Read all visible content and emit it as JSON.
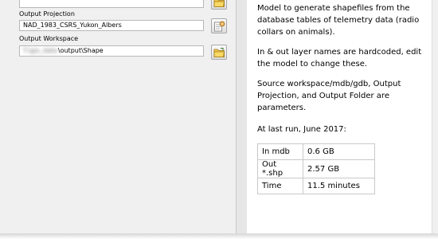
{
  "form": {
    "output_projection": {
      "label": "Output Projection",
      "value": "NAD_1983_CSRS_Yukon_Albers"
    },
    "output_workspace": {
      "label": "Output Workspace",
      "value_blurred": "T:\\gis_data",
      "value": "\\output\\Shape"
    }
  },
  "help": {
    "paragraphs": [
      "Model to generate shapefiles from the database tables of telemetry data (radio collars on animals).",
      "In & out layer names are hardcoded, edit the model to change these.",
      "Source workspace/mdb/gdb, Output Projection, and Output Folder are parameters.",
      "At last run, June 2017:"
    ],
    "stats": [
      {
        "label": "In mdb",
        "value": "0.6 GB"
      },
      {
        "label": "Out *.shp",
        "value": "2.57 GB"
      },
      {
        "label": "Time",
        "value": "11.5 minutes"
      }
    ]
  },
  "icons": {
    "folder_top": "folder-icon",
    "projection": "coordinate-system-icon",
    "folder_workspace": "folder-icon"
  },
  "colors": {
    "pane_bg": "#f0f0f0",
    "folder_yellow": "#e8b630"
  }
}
